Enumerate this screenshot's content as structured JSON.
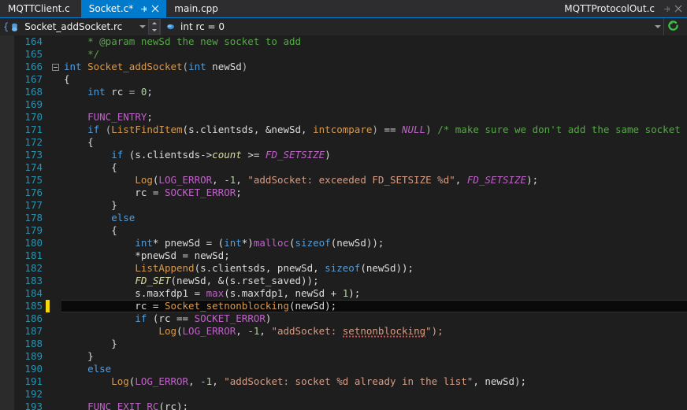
{
  "window": {
    "right_title": "MQTTProtocolOut.c",
    "right_pin_icon": "pin-icon",
    "right_close_icon": "close-icon"
  },
  "tabs": [
    {
      "label": "MQTTClient.c",
      "active": false,
      "dirty": false
    },
    {
      "label": "Socket.c*",
      "active": true,
      "dirty": true,
      "pin_icon": "pin-icon",
      "close_icon": "close-icon"
    },
    {
      "label": "main.cpp",
      "active": false,
      "dirty": false
    }
  ],
  "navbar": {
    "scope_icon": "struct-member-icon",
    "scope_value": "Socket_addSocket.rc",
    "scope_dropdown_icon": "chevron-down-icon",
    "spinner_up_icon": "chevron-up-icon",
    "spinner_down_icon": "chevron-down-icon",
    "member_icon": "field-icon",
    "member_value": "int rc = 0",
    "member_dropdown_icon": "chevron-down-icon",
    "refresh_icon": "refresh-icon"
  },
  "editor": {
    "current_line": 185,
    "changed_lines": [
      185
    ],
    "first_line": 164,
    "lines": [
      {
        "n": 164,
        "fold": false,
        "guide": "end",
        "tokens": [
          {
            "t": "    ",
            "c": "t-plain"
          },
          {
            "t": "* @param newSd the new socket to add",
            "c": "t-cmt"
          }
        ]
      },
      {
        "n": 165,
        "fold": false,
        "guide": "none",
        "tokens": [
          {
            "t": "    ",
            "c": "t-plain"
          },
          {
            "t": "*/",
            "c": "t-cmt"
          }
        ]
      },
      {
        "n": 166,
        "fold": true,
        "guide": "none",
        "tokens": [
          {
            "t": "int ",
            "c": "t-kw"
          },
          {
            "t": "Socket_addSocket",
            "c": "t-fn"
          },
          {
            "t": "(",
            "c": "t-op"
          },
          {
            "t": "int",
            "c": "t-kw"
          },
          {
            "t": " newSd",
            "c": "t-plain"
          },
          {
            "t": ")",
            "c": "t-op"
          }
        ]
      },
      {
        "n": 167,
        "fold": false,
        "guide": "start",
        "tokens": [
          {
            "t": "{",
            "c": "t-plain"
          }
        ]
      },
      {
        "n": 168,
        "fold": false,
        "guide": "full",
        "tokens": [
          {
            "t": "    ",
            "c": "t-plain"
          },
          {
            "t": "int",
            "c": "t-kw"
          },
          {
            "t": " rc ",
            "c": "t-plain"
          },
          {
            "t": "=",
            "c": "t-op"
          },
          {
            "t": " ",
            "c": "t-plain"
          },
          {
            "t": "0",
            "c": "t-num"
          },
          {
            "t": ";",
            "c": "t-plain"
          }
        ]
      },
      {
        "n": 169,
        "fold": false,
        "guide": "full",
        "tokens": []
      },
      {
        "n": 170,
        "fold": false,
        "guide": "full",
        "tokens": [
          {
            "t": "    ",
            "c": "t-plain"
          },
          {
            "t": "FUNC_ENTRY",
            "c": "t-macro"
          },
          {
            "t": ";",
            "c": "t-plain"
          }
        ]
      },
      {
        "n": 171,
        "fold": false,
        "guide": "full",
        "tokens": [
          {
            "t": "    ",
            "c": "t-plain"
          },
          {
            "t": "if",
            "c": "t-kw"
          },
          {
            "t": " (",
            "c": "t-op"
          },
          {
            "t": "ListFindItem",
            "c": "t-fn"
          },
          {
            "t": "(s.clientsds, &newSd, ",
            "c": "t-plain"
          },
          {
            "t": "intcompare",
            "c": "t-fn"
          },
          {
            "t": ")",
            "c": "t-op"
          },
          {
            "t": " == ",
            "c": "t-plain"
          },
          {
            "t": "NULL",
            "c": "t-macroi"
          },
          {
            "t": ")",
            "c": "t-op"
          },
          {
            "t": " ",
            "c": "t-plain"
          },
          {
            "t": "/* make sure we don't add the same socket twice */",
            "c": "t-cmt"
          },
          {
            "t": " .",
            "c": "t-cmt"
          }
        ]
      },
      {
        "n": 172,
        "fold": false,
        "guide": "full",
        "tokens": [
          {
            "t": "    {",
            "c": "t-plain"
          }
        ]
      },
      {
        "n": 173,
        "fold": false,
        "guide": "full",
        "tokens": [
          {
            "t": "        ",
            "c": "t-plain"
          },
          {
            "t": "if",
            "c": "t-kw"
          },
          {
            "t": " (s.clientsds->",
            "c": "t-plain"
          },
          {
            "t": "count",
            "c": "t-field"
          },
          {
            "t": " >= ",
            "c": "t-plain"
          },
          {
            "t": "FD_SETSIZE",
            "c": "t-macroi"
          },
          {
            "t": ")",
            "c": "t-plain"
          }
        ]
      },
      {
        "n": 174,
        "fold": false,
        "guide": "full",
        "tokens": [
          {
            "t": "        {",
            "c": "t-plain"
          }
        ]
      },
      {
        "n": 175,
        "fold": false,
        "guide": "full",
        "tokens": [
          {
            "t": "            ",
            "c": "t-plain"
          },
          {
            "t": "Log",
            "c": "t-fn"
          },
          {
            "t": "(",
            "c": "t-plain"
          },
          {
            "t": "LOG_ERROR",
            "c": "t-macro"
          },
          {
            "t": ", ",
            "c": "t-plain"
          },
          {
            "t": "-1",
            "c": "t-num"
          },
          {
            "t": ", ",
            "c": "t-plain"
          },
          {
            "t": "\"addSocket: exceeded FD_SETSIZE %d\"",
            "c": "t-str"
          },
          {
            "t": ", ",
            "c": "t-plain"
          },
          {
            "t": "FD_SETSIZE",
            "c": "t-macroi"
          },
          {
            "t": ");",
            "c": "t-plain"
          }
        ]
      },
      {
        "n": 176,
        "fold": false,
        "guide": "full",
        "tokens": [
          {
            "t": "            rc = ",
            "c": "t-plain"
          },
          {
            "t": "SOCKET_ERROR",
            "c": "t-macro"
          },
          {
            "t": ";",
            "c": "t-plain"
          }
        ]
      },
      {
        "n": 177,
        "fold": false,
        "guide": "full",
        "tokens": [
          {
            "t": "        }",
            "c": "t-plain"
          }
        ]
      },
      {
        "n": 178,
        "fold": false,
        "guide": "full",
        "tokens": [
          {
            "t": "        ",
            "c": "t-plain"
          },
          {
            "t": "else",
            "c": "t-kw"
          }
        ]
      },
      {
        "n": 179,
        "fold": false,
        "guide": "full",
        "tokens": [
          {
            "t": "        {",
            "c": "t-plain"
          }
        ]
      },
      {
        "n": 180,
        "fold": false,
        "guide": "full",
        "tokens": [
          {
            "t": "            ",
            "c": "t-plain"
          },
          {
            "t": "int",
            "c": "t-kw"
          },
          {
            "t": "* pnewSd = (",
            "c": "t-plain"
          },
          {
            "t": "int",
            "c": "t-kw"
          },
          {
            "t": "*)",
            "c": "t-plain"
          },
          {
            "t": "malloc",
            "c": "t-macro"
          },
          {
            "t": "(",
            "c": "t-plain"
          },
          {
            "t": "sizeof",
            "c": "t-kw"
          },
          {
            "t": "(newSd));",
            "c": "t-plain"
          }
        ]
      },
      {
        "n": 181,
        "fold": false,
        "guide": "full",
        "tokens": [
          {
            "t": "            *pnewSd = newSd;",
            "c": "t-plain"
          }
        ]
      },
      {
        "n": 182,
        "fold": false,
        "guide": "full",
        "tokens": [
          {
            "t": "            ",
            "c": "t-plain"
          },
          {
            "t": "ListAppend",
            "c": "t-fn"
          },
          {
            "t": "(s.clientsds, pnewSd, ",
            "c": "t-plain"
          },
          {
            "t": "sizeof",
            "c": "t-kw"
          },
          {
            "t": "(newSd));",
            "c": "t-plain"
          }
        ]
      },
      {
        "n": 183,
        "fold": false,
        "guide": "full",
        "tokens": [
          {
            "t": "            ",
            "c": "t-plain"
          },
          {
            "t": "FD_SET",
            "c": "t-fdset"
          },
          {
            "t": "(newSd, &(s.rset_saved));",
            "c": "t-plain"
          }
        ]
      },
      {
        "n": 184,
        "fold": false,
        "guide": "full",
        "tokens": [
          {
            "t": "            s.maxfdp1 = ",
            "c": "t-plain"
          },
          {
            "t": "max",
            "c": "t-macro"
          },
          {
            "t": "(s.maxfdp1, newSd + ",
            "c": "t-plain"
          },
          {
            "t": "1",
            "c": "t-num"
          },
          {
            "t": ");",
            "c": "t-plain"
          }
        ]
      },
      {
        "n": 185,
        "fold": false,
        "guide": "full",
        "tokens": [
          {
            "t": "            rc = ",
            "c": "t-plain"
          },
          {
            "t": "Socket_setnonblocking",
            "c": "t-fn"
          },
          {
            "t": "(newSd);",
            "c": "t-plain"
          }
        ]
      },
      {
        "n": 186,
        "fold": false,
        "guide": "full",
        "tokens": [
          {
            "t": "            ",
            "c": "t-plain"
          },
          {
            "t": "if",
            "c": "t-kw"
          },
          {
            "t": " (rc == ",
            "c": "t-plain"
          },
          {
            "t": "SOCKET_ERROR",
            "c": "t-macro"
          },
          {
            "t": ")",
            "c": "t-plain"
          }
        ]
      },
      {
        "n": 187,
        "fold": false,
        "guide": "full",
        "tokens": [
          {
            "t": "                ",
            "c": "t-plain"
          },
          {
            "t": "Log",
            "c": "t-fn"
          },
          {
            "t": "(",
            "c": "t-plain"
          },
          {
            "t": "LOG_ERROR",
            "c": "t-macro"
          },
          {
            "t": ", ",
            "c": "t-plain"
          },
          {
            "t": "-1",
            "c": "t-num"
          },
          {
            "t": ", ",
            "c": "t-plain"
          },
          {
            "t": "\"addSocket: ",
            "c": "t-str"
          },
          {
            "t": "setnonblocking",
            "c": "t-str squiggle"
          },
          {
            "t": "\");",
            "c": "t-str"
          }
        ]
      },
      {
        "n": 188,
        "fold": false,
        "guide": "full",
        "tokens": [
          {
            "t": "        }",
            "c": "t-plain"
          }
        ]
      },
      {
        "n": 189,
        "fold": false,
        "guide": "full",
        "tokens": [
          {
            "t": "    }",
            "c": "t-plain"
          }
        ]
      },
      {
        "n": 190,
        "fold": false,
        "guide": "full",
        "tokens": [
          {
            "t": "    ",
            "c": "t-plain"
          },
          {
            "t": "else",
            "c": "t-kw"
          }
        ]
      },
      {
        "n": 191,
        "fold": false,
        "guide": "full",
        "tokens": [
          {
            "t": "        ",
            "c": "t-plain"
          },
          {
            "t": "Log",
            "c": "t-fn"
          },
          {
            "t": "(",
            "c": "t-plain"
          },
          {
            "t": "LOG_ERROR",
            "c": "t-macro"
          },
          {
            "t": ", ",
            "c": "t-plain"
          },
          {
            "t": "-1",
            "c": "t-num"
          },
          {
            "t": ", ",
            "c": "t-plain"
          },
          {
            "t": "\"addSocket: socket %d already in the list\"",
            "c": "t-str"
          },
          {
            "t": ", newSd);",
            "c": "t-plain"
          }
        ]
      },
      {
        "n": 192,
        "fold": false,
        "guide": "full",
        "tokens": []
      },
      {
        "n": 193,
        "fold": false,
        "guide": "full",
        "tokens": [
          {
            "t": "    ",
            "c": "t-plain"
          },
          {
            "t": "FUNC_EXIT_RC",
            "c": "t-macro"
          },
          {
            "t": "(rc);",
            "c": "t-plain"
          }
        ]
      }
    ]
  },
  "colors": {
    "accent": "#007acc",
    "tabbar_bg": "#2d2d30",
    "editor_bg": "#1e1e1e",
    "line_number": "#2b91af",
    "comment": "#57a64a",
    "string": "#d69d85",
    "keyword": "#569cd6",
    "macro": "#bd63c5",
    "function": "#d69a52",
    "changed_marker": "#f5d90a",
    "error_squiggle": "#e05252"
  }
}
